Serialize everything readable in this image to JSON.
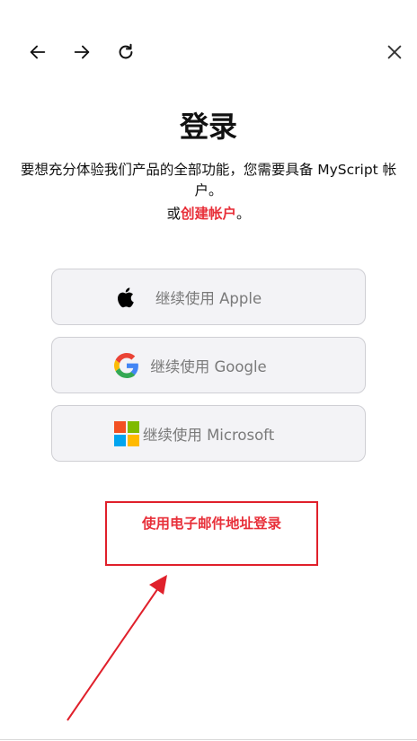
{
  "toolbar": {
    "back_icon": "arrow-left-icon",
    "forward_icon": "arrow-right-icon",
    "reload_icon": "reload-icon",
    "close_icon": "close-icon"
  },
  "header": {
    "title": "登录",
    "subtitle": "要想充分体验我们产品的全部功能，您需要具备 MyScript 帐户。",
    "or_prefix": "或",
    "create_account_link": "创建帐户",
    "create_account_suffix": "。"
  },
  "sso": {
    "apple_label": "继续使用 Apple",
    "google_label": "继续使用 Google",
    "microsoft_label": "继续使用 Microsoft"
  },
  "email": {
    "login_link": "使用电子邮件地址登录"
  },
  "colors": {
    "accent_red": "#e8303a",
    "button_bg": "#f3f3f6",
    "annotation_red": "#e0202b"
  }
}
